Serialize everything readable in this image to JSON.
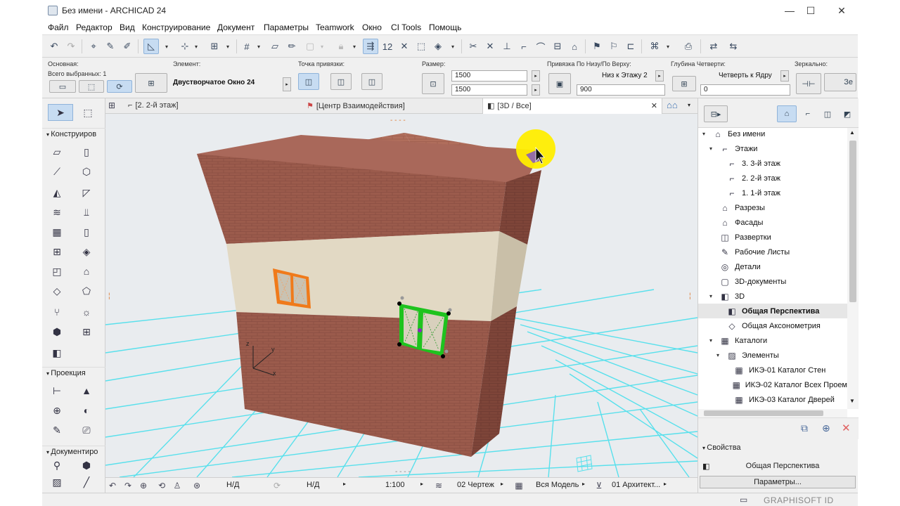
{
  "window": {
    "title": "Без имени - ARCHICAD 24",
    "minimize": "—",
    "maximize": "☐",
    "close": "✕"
  },
  "menu": [
    "Файл",
    "Редактор",
    "Вид",
    "Конструирование",
    "Документ",
    "Параметры",
    "Teamwork",
    "Окно",
    "CI Tools",
    "Помощь"
  ],
  "infobox": {
    "main_label": "Основная:",
    "all_selected": "Всего выбранных: 1",
    "element_label": "Элемент:",
    "element_value": "Двустворчатое Окно 24",
    "snap_label": "Точка привязки:",
    "size_label": "Размер:",
    "width": "1500",
    "height": "1500",
    "anchor_label": "Привязка По Низу/По Верху:",
    "anchor_value": "Низ к Этажу 2",
    "anchor_offset": "900",
    "depth_label": "Глубина Четверти:",
    "depth_value": "Четверть к Ядру",
    "depth_offset": "0",
    "mirror_label": "Зеркально:",
    "mirror_value": "Зе"
  },
  "toolbox": {
    "section_design": "Конструиров",
    "section_projection": "Проекция",
    "section_document": "Документиро"
  },
  "tabs": [
    {
      "label": "[2. 2-й этаж]"
    },
    {
      "label": "[Центр Взаимодействия]"
    },
    {
      "label": "[3D / Все]"
    }
  ],
  "navigator": {
    "items": [
      {
        "label": "Без имени",
        "depth": 0,
        "icon": "project-icon",
        "caret": "▾"
      },
      {
        "label": "Этажи",
        "depth": 1,
        "icon": "stories-icon",
        "caret": "▾"
      },
      {
        "label": "3. 3-й этаж",
        "depth": 2,
        "icon": "story-icon",
        "caret": ""
      },
      {
        "label": "2. 2-й этаж",
        "depth": 2,
        "icon": "story-icon",
        "caret": ""
      },
      {
        "label": "1. 1-й этаж",
        "depth": 2,
        "icon": "story-icon",
        "caret": ""
      },
      {
        "label": "Разрезы",
        "depth": 1,
        "icon": "sections-icon",
        "caret": ""
      },
      {
        "label": "Фасады",
        "depth": 1,
        "icon": "elevations-icon",
        "caret": ""
      },
      {
        "label": "Развертки",
        "depth": 1,
        "icon": "interior-elevations-icon",
        "caret": ""
      },
      {
        "label": "Рабочие Листы",
        "depth": 1,
        "icon": "worksheets-icon",
        "caret": ""
      },
      {
        "label": "Детали",
        "depth": 1,
        "icon": "details-icon",
        "caret": ""
      },
      {
        "label": "3D-документы",
        "depth": 1,
        "icon": "3d-documents-icon",
        "caret": ""
      },
      {
        "label": "3D",
        "depth": 1,
        "icon": "3d-icon",
        "caret": "▾"
      },
      {
        "label": "Общая Перспектива",
        "depth": 2,
        "icon": "perspective-icon",
        "caret": "",
        "selected": true
      },
      {
        "label": "Общая Аксонометрия",
        "depth": 2,
        "icon": "axonometry-icon",
        "caret": ""
      },
      {
        "label": "Каталоги",
        "depth": 1,
        "icon": "schedules-icon",
        "caret": "▾"
      },
      {
        "label": "Элементы",
        "depth": 2,
        "icon": "elements-icon",
        "caret": "▾"
      },
      {
        "label": "ИКЭ-01 Каталог Стен",
        "depth": 3,
        "icon": "table-icon",
        "caret": ""
      },
      {
        "label": "ИКЭ-02 Каталог Всех Проем",
        "depth": 3,
        "icon": "table-icon",
        "caret": ""
      },
      {
        "label": "ИКЭ-03 Каталог Дверей",
        "depth": 3,
        "icon": "table-icon",
        "caret": ""
      }
    ]
  },
  "properties": {
    "header": "Свойства",
    "view_name": "Общая Перспектива",
    "params_button": "Параметры..."
  },
  "status": {
    "nd1": "Н/Д",
    "nd2": "Н/Д",
    "scale": "1:100",
    "pen_set": "02 Чертеж",
    "model_view": "Вся Модель",
    "renovation": "01 Архитект..."
  },
  "footer": {
    "brand": "GRAPHISOFT ID"
  },
  "colors": {
    "accent": "#c7dcf2",
    "brick": "#9a5a4c",
    "plaster": "#e2d9c4",
    "grid": "#5fe0ec",
    "selection": "#1ec31e",
    "window_orange": "#f07a1a",
    "cursor_highlight": "#ffee00"
  }
}
